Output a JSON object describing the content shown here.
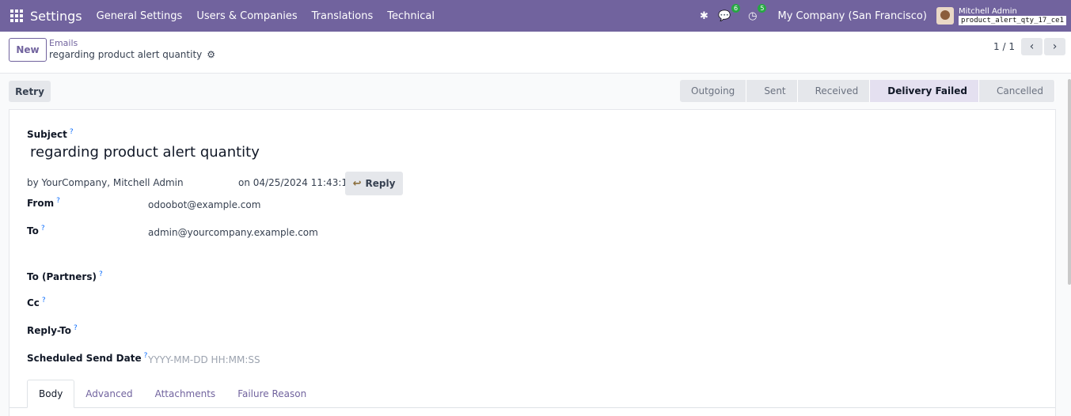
{
  "navbar": {
    "app_title": "Settings",
    "menu": [
      "General Settings",
      "Users & Companies",
      "Translations",
      "Technical"
    ],
    "messages_count": "6",
    "activities_count": "5",
    "company": "My Company (San Francisco)",
    "user_name": "Mitchell Admin",
    "db_name": "product_alert_qty_17_ce1",
    "brand_color": "#71639e"
  },
  "control": {
    "new_label": "New",
    "breadcrumb_parent": "Emails",
    "breadcrumb_current": "regarding product alert quantity",
    "pager": "1 / 1"
  },
  "actions": {
    "retry_label": "Retry"
  },
  "statusbar": {
    "stages": [
      "Outgoing",
      "Sent",
      "Received",
      "Delivery Failed",
      "Cancelled"
    ],
    "active": "Delivery Failed"
  },
  "form": {
    "subject_label": "Subject",
    "subject": "regarding product alert quantity",
    "by_text": "by  YourCompany, Mitchell Admin",
    "on_text": "on 04/25/2024 11:43:11",
    "reply_label": "Reply",
    "from_label": "From",
    "from_value": "odoobot@example.com",
    "to_label": "To",
    "to_value": "admin@yourcompany.example.com",
    "to_partners_label": "To (Partners)",
    "cc_label": "Cc",
    "reply_to_label": "Reply-To",
    "scheduled_label": "Scheduled Send Date",
    "scheduled_placeholder": "YYYY-MM-DD HH:MM:SS",
    "help_mark": "?"
  },
  "tabs": [
    "Body",
    "Advanced",
    "Attachments",
    "Failure Reason"
  ]
}
